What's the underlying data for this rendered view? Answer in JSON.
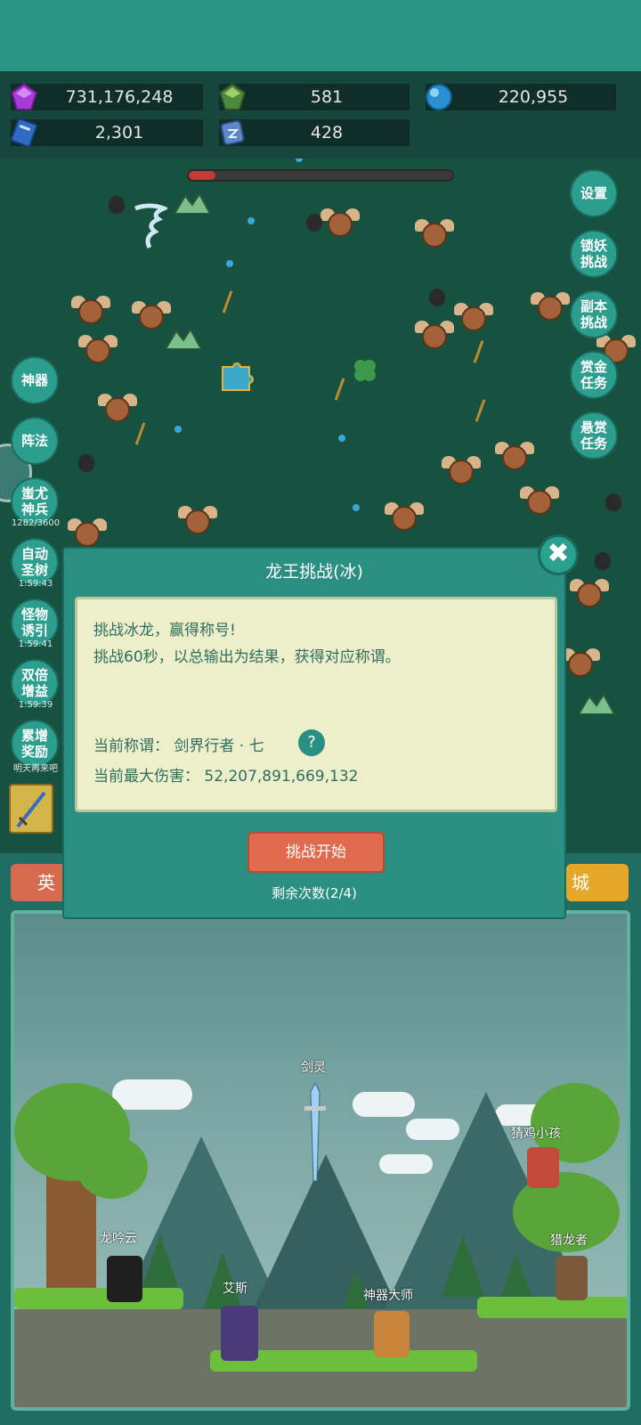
{
  "resources": [
    {
      "icon": "purple-gem-icon",
      "value": "731,176,248"
    },
    {
      "icon": "green-gem-icon",
      "value": "581"
    },
    {
      "icon": "blue-orb-icon",
      "value": "220,955"
    },
    {
      "icon": "blue-book-icon",
      "value": "2,301"
    },
    {
      "icon": "rune-stone-icon",
      "value": "428"
    }
  ],
  "boss_hp_fraction": 0.1,
  "right_menu": [
    {
      "label": "设置"
    },
    {
      "label": "锁妖\n挑战"
    },
    {
      "label": "副本\n挑战"
    },
    {
      "label": "赏金\n任务"
    },
    {
      "label": "悬赏\n任务"
    }
  ],
  "left_menu": [
    {
      "label": "神器",
      "timer": ""
    },
    {
      "label": "阵法",
      "timer": ""
    },
    {
      "label": "蚩尤\n神兵",
      "timer": "1282/3600"
    },
    {
      "label": "自动\n圣树",
      "timer": "1:59:43"
    },
    {
      "label": "怪物\n诱引",
      "timer": "1:59:41"
    },
    {
      "label": "双倍\n增益",
      "timer": "1:59:39"
    },
    {
      "label": "累增\n奖励",
      "timer": "明天再来吧"
    }
  ],
  "bottom_tabs": {
    "left": "英",
    "right": "城"
  },
  "scene": {
    "characters": [
      {
        "label": "剑灵"
      },
      {
        "label": "猜鸡小孩"
      },
      {
        "label": "龙吟云"
      },
      {
        "label": "猎龙者"
      },
      {
        "label": "艾斯"
      },
      {
        "label": "神器大师"
      }
    ]
  },
  "modal": {
    "title": "龙王挑战(冰)",
    "desc_line1": "挑战冰龙，赢得称号!",
    "desc_line2": "挑战60秒，以总输出为结果，获得对应称谓。",
    "title_label": "当前称谓：",
    "title_value": "剑界行者 · 七",
    "damage_label": "当前最大伤害：",
    "damage_value": "52,207,891,669,132",
    "help": "?",
    "start_button": "挑战开始",
    "remaining": "剩余次数(2/4)",
    "close": "✖"
  }
}
